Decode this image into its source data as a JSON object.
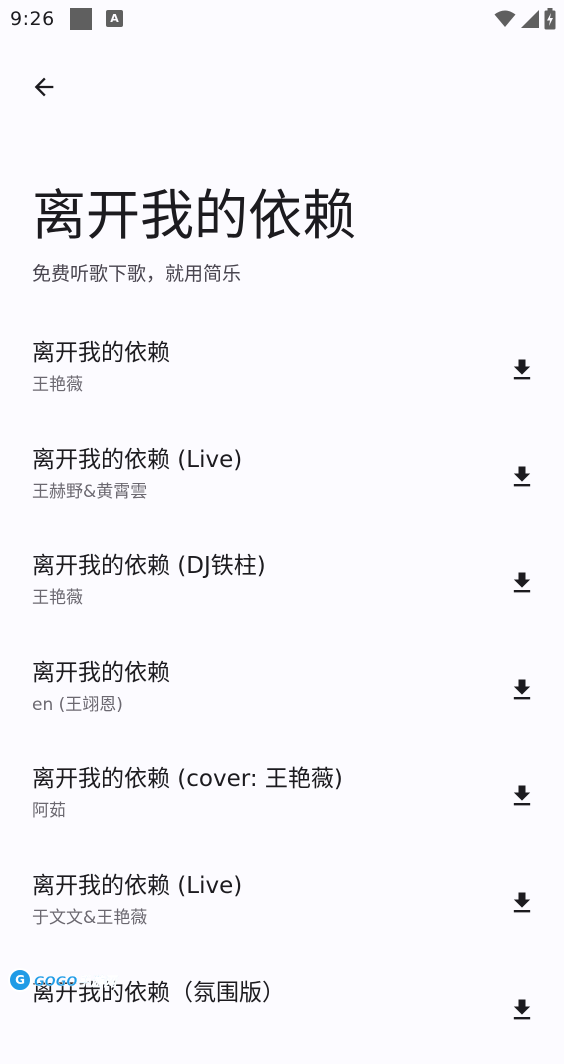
{
  "status_bar": {
    "time": "9:26",
    "notification_icons": [
      "square-icon",
      "a-icon"
    ],
    "system_icons": [
      "wifi-icon",
      "signal-icon",
      "battery-charging-icon"
    ]
  },
  "header": {
    "back_icon": "arrow-back-icon",
    "title": "离开我的依赖",
    "subtitle": "免费听歌下歌，就用简乐"
  },
  "songs": [
    {
      "title": "离开我的依赖",
      "artist": "王艳薇"
    },
    {
      "title": "离开我的依赖 (Live)",
      "artist": "王赫野&黄霄雲"
    },
    {
      "title": "离开我的依赖 (DJ铁柱)",
      "artist": "王艳薇"
    },
    {
      "title": "离开我的依赖",
      "artist": "en (王翊恩)"
    },
    {
      "title": "离开我的依赖 (cover: 王艳薇)",
      "artist": "阿茹"
    },
    {
      "title": "离开我的依赖 (Live)",
      "artist": "于文文&王艳薇"
    },
    {
      "title": "离开我的依赖（氛围版）",
      "artist": ""
    }
  ],
  "watermark": {
    "logo_text": "G",
    "text": "GOGO手游网"
  },
  "colors": {
    "background": "#fcfbff",
    "text_primary": "#1c1b1f",
    "text_secondary": "#6b6870",
    "watermark_blue": "#1f9be6"
  }
}
